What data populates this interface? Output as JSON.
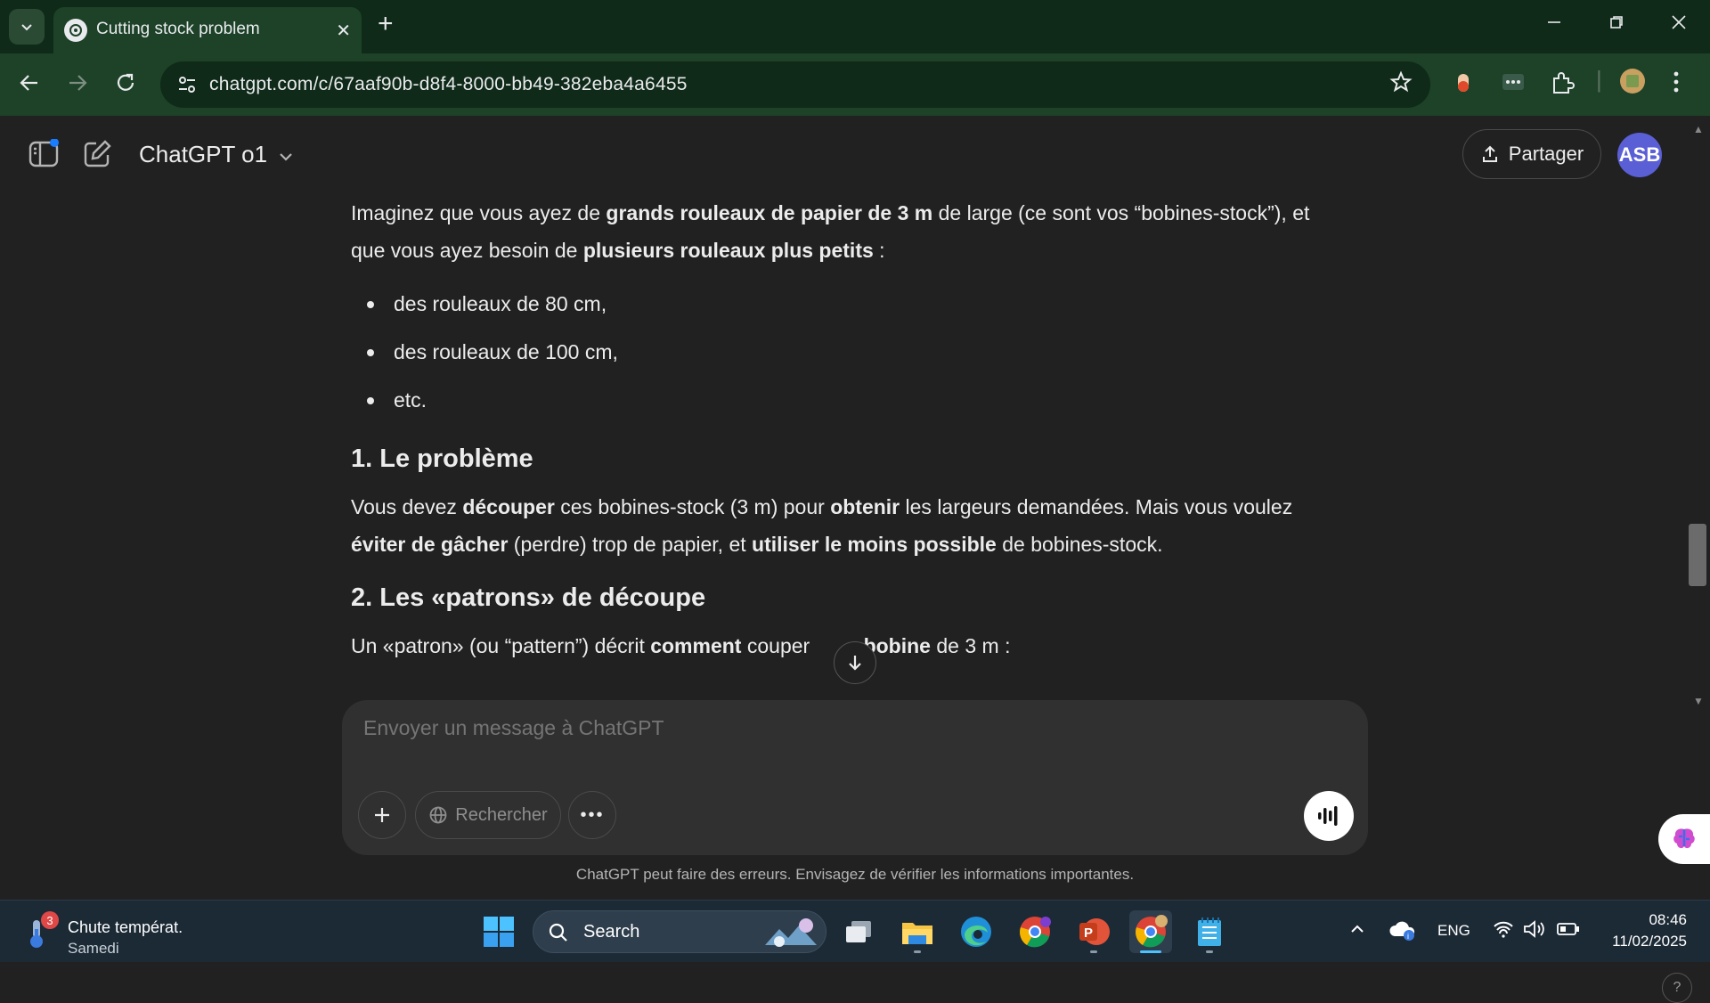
{
  "browser": {
    "tab_title": "Cutting stock problem",
    "tab_close": "✕",
    "new_tab": "+",
    "url": "chatgpt.com/c/67aaf90b-d8f4-8000-bb49-382eba4a6455"
  },
  "header": {
    "model_name": "ChatGPT o1",
    "share_label": "Partager",
    "avatar_initials": "ASB"
  },
  "content": {
    "intro": {
      "t1": "Imaginez que vous ayez de ",
      "b1": "grands rouleaux de papier de 3 m",
      "t2": " de large (ce sont vos “bobines-stock”), et que vous ayez besoin de ",
      "b2": "plusieurs rouleaux plus petits",
      "t3": " :"
    },
    "list_items": [
      "des rouleaux de 80 cm,",
      "des rouleaux de 100 cm,",
      "etc."
    ],
    "section1": {
      "heading": "1. Le problème",
      "t1": "Vous devez ",
      "b1": "découper",
      "t2": " ces bobines-stock (3 m) pour ",
      "b2": "obtenir",
      "t3": " les largeurs demandées. Mais vous voulez ",
      "b3": "éviter de gâcher",
      "t4": " (perdre) trop de papier, et ",
      "b4": "utiliser le moins possible",
      "t5": " de bobines-stock."
    },
    "section2": {
      "heading": "2. Les «patrons» de découpe",
      "t1": "Un «patron» (ou “pattern”) décrit ",
      "b1": "comment",
      "t2": " couper ",
      "b2": "bobine",
      "t3": " de 3 m :"
    }
  },
  "composer": {
    "placeholder": "Envoyer un message à ChatGPT",
    "search_label": "Rechercher",
    "more_label": "•••"
  },
  "disclaimer": "ChatGPT peut faire des erreurs. Envisagez de vérifier les informations importantes.",
  "taskbar": {
    "weather_badge": "3",
    "weather_title": "Chute températ.",
    "weather_sub": "Samedi",
    "search_label": "Search",
    "language": "ENG",
    "time": "08:46",
    "date": "11/02/2025"
  },
  "colors": {
    "page_bg": "#212121",
    "chrome_tabstrip": "#0f2a18",
    "chrome_toolbar": "#1d4228",
    "avatar": "#5b5fd6",
    "taskbar": "#1c2a36"
  }
}
